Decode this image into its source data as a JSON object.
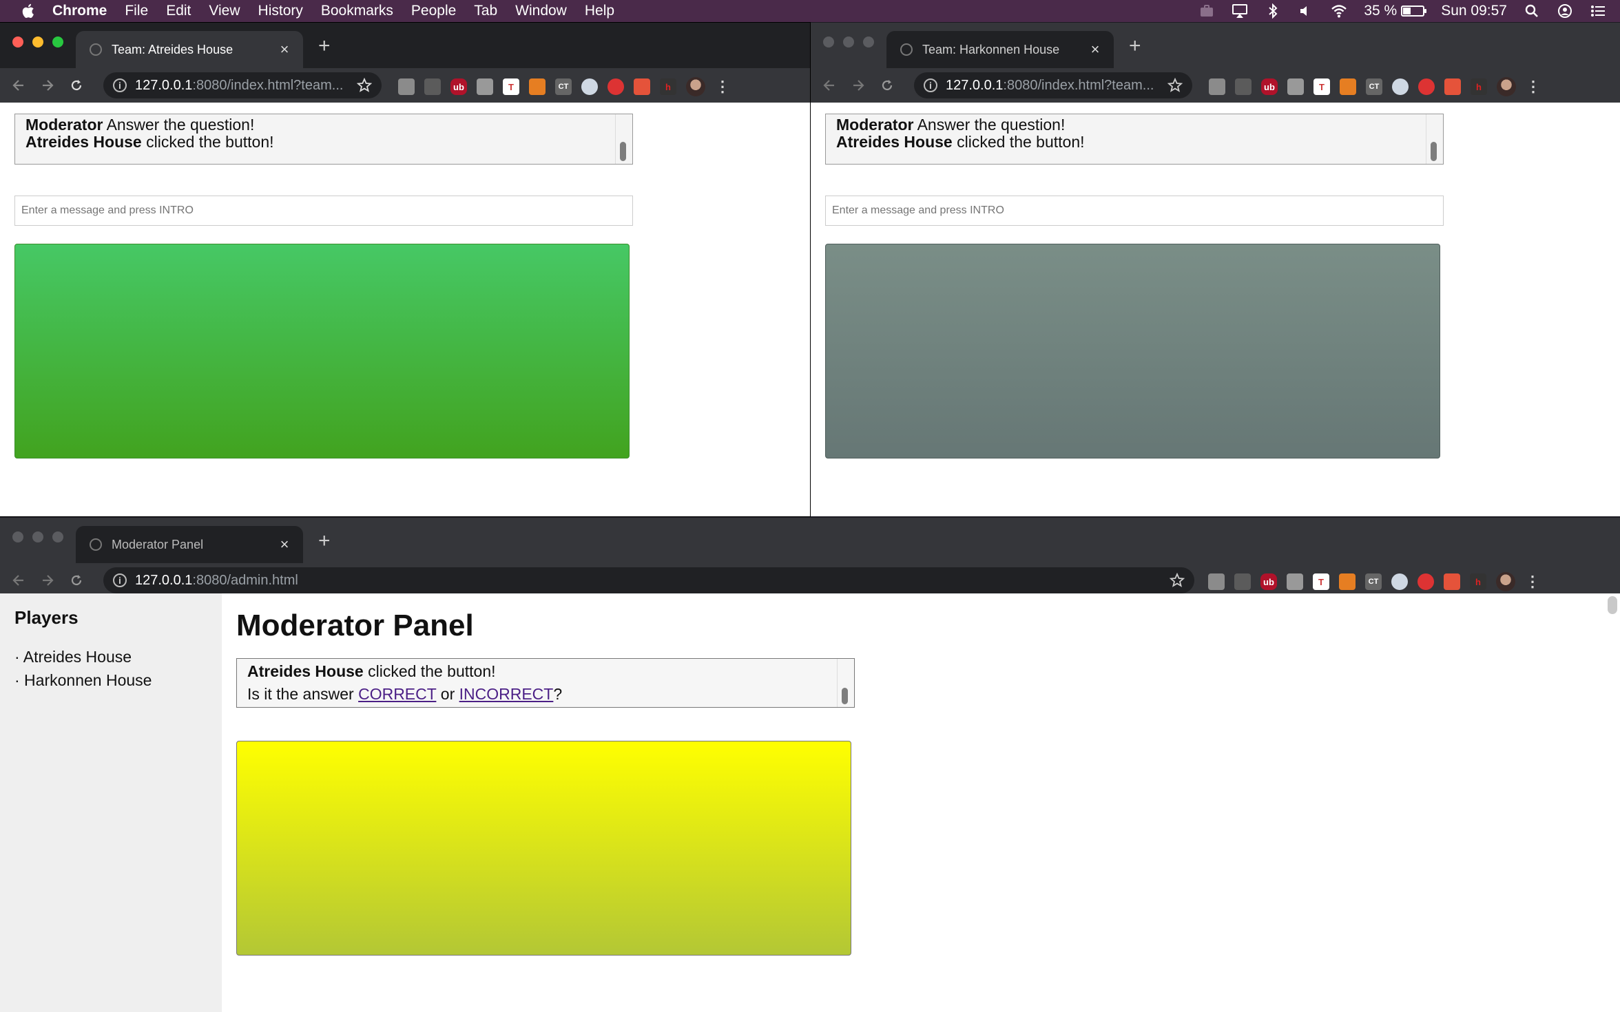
{
  "menubar": {
    "app": "Chrome",
    "items": [
      "File",
      "Edit",
      "View",
      "History",
      "Bookmarks",
      "People",
      "Tab",
      "Window",
      "Help"
    ],
    "battery_text": "35 %",
    "battery_level": 0.35,
    "clock": "Sun 09:57"
  },
  "win_atreides": {
    "tab_title": "Team: Atreides House",
    "url_host": "127.0.0.1",
    "url_path": ":8080/index.html?team...",
    "log": [
      {
        "who": "Moderator",
        "text": " Answer the question!"
      },
      {
        "who": "Atreides House",
        "text": " clicked the button!"
      }
    ],
    "input_placeholder": "Enter a message and press INTRO",
    "button_color": "#46c865"
  },
  "win_harkonnen": {
    "tab_title": "Team: Harkonnen House",
    "url_host": "127.0.0.1",
    "url_path": ":8080/index.html?team...",
    "log": [
      {
        "who": "Moderator",
        "text": " Answer the question!"
      },
      {
        "who": "Atreides House",
        "text": " clicked the button!"
      }
    ],
    "input_placeholder": "Enter a message and press INTRO",
    "button_color": "#738680"
  },
  "win_moderator": {
    "tab_title": "Moderator Panel",
    "url_host": "127.0.0.1",
    "url_path": ":8080/admin.html",
    "sidebar_title": "Players",
    "players": [
      "· Atreides House",
      "· Harkonnen House"
    ],
    "title": "Moderator Panel",
    "log_who": "Atreides House",
    "log_text": " clicked the button!",
    "question_prefix": "Is it the answer ",
    "correct_label": "CORRECT",
    "or_text": " or ",
    "incorrect_label": "INCORRECT",
    "question_suffix": "?",
    "button_color": "#ffff00"
  }
}
